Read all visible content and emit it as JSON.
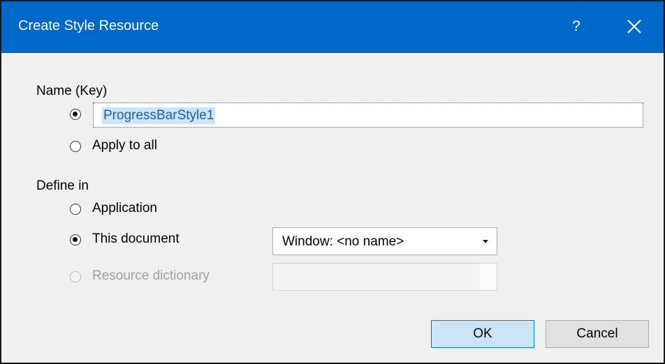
{
  "window": {
    "title": "Create Style Resource",
    "help_label": "?",
    "close_icon": "close-icon"
  },
  "name_section": {
    "heading": "Name (Key)",
    "key_value": "ProgressBarStyle1",
    "apply_to_all_label": "Apply to all",
    "selected_option": "key"
  },
  "define_section": {
    "heading": "Define in",
    "application_label": "Application",
    "this_document_label": "This document",
    "resource_dictionary_label": "Resource dictionary",
    "selected_option": "this_document",
    "document_target": "Window: <no name>",
    "resource_dictionary_value": ""
  },
  "buttons": {
    "ok": "OK",
    "cancel": "Cancel"
  },
  "colors": {
    "titlebar": "#0068c9",
    "dialog_bg": "#f0f0f0",
    "ok_button": "#cce4f7",
    "selection": "#cce4f7"
  }
}
